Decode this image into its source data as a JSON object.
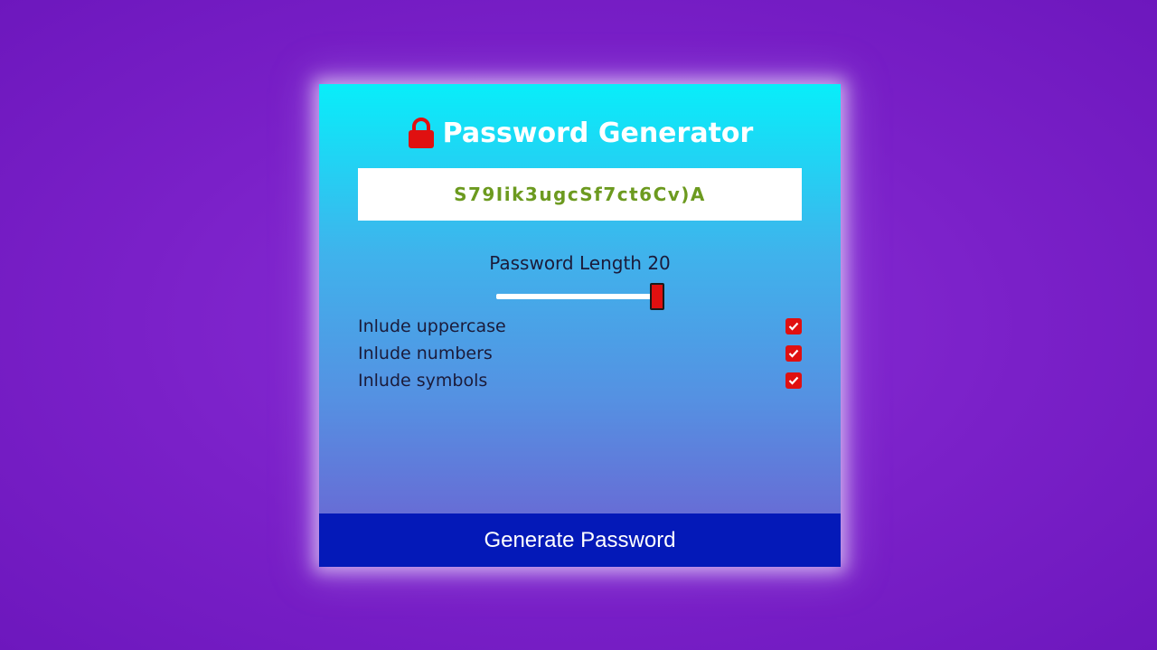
{
  "app": {
    "title": "Password Generator",
    "icon": "lock-icon"
  },
  "password": {
    "value": "S79Iik3ugcSf7ct6Cv)A",
    "color": "#6c9a1f"
  },
  "length": {
    "label": "Password Length 20",
    "value": 20,
    "slider_fraction": 1.0
  },
  "options": [
    {
      "label": "Inlude uppercase",
      "checked": true
    },
    {
      "label": "Inlude numbers",
      "checked": true
    },
    {
      "label": "Inlude symbols",
      "checked": true
    }
  ],
  "generate_button": {
    "label": "Generate Password"
  },
  "colors": {
    "background": "#7a20c8",
    "button": "#0419b8",
    "accent": "#e01010",
    "card_top": "#08eefa",
    "card_bottom": "#6f5dd0"
  }
}
